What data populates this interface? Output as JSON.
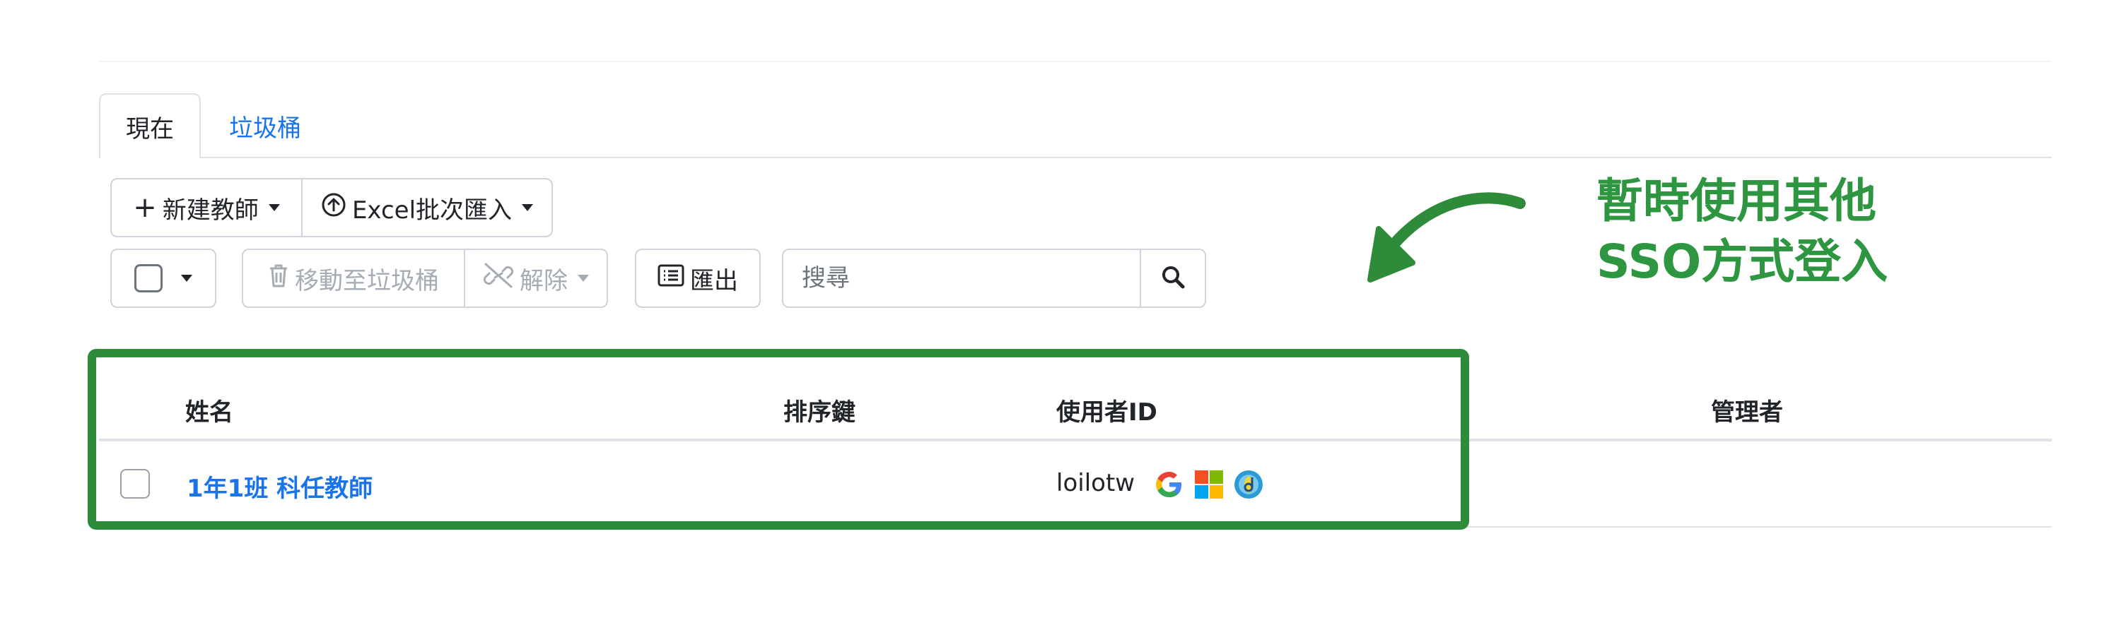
{
  "tabs": [
    {
      "label": "現在",
      "active": true
    },
    {
      "label": "垃圾桶",
      "active": false
    }
  ],
  "toolbar": {
    "new_teacher_label": "新建教師",
    "excel_import_label": "Excel批次匯入",
    "move_to_trash_label": "移動至垃圾桶",
    "unlink_label": "解除",
    "export_label": "匯出",
    "search_placeholder": "搜尋"
  },
  "table": {
    "headers": {
      "name": "姓名",
      "sort_key": "排序鍵",
      "user_id": "使用者ID",
      "admin": "管理者"
    },
    "rows": [
      {
        "name": "1年1班 科任教師",
        "sort_key": "",
        "user_id": "loilotw",
        "sso_icons": [
          "google-icon",
          "microsoft-icon",
          "sso-icon"
        ],
        "admin": ""
      }
    ]
  },
  "annotation": {
    "line1": "暫時使用其他",
    "line2": "SSO方式登入"
  },
  "colors": {
    "link": "#1a73e8",
    "highlight": "#2e8b3a",
    "annotation": "#2e9640",
    "border": "#ced4da"
  }
}
